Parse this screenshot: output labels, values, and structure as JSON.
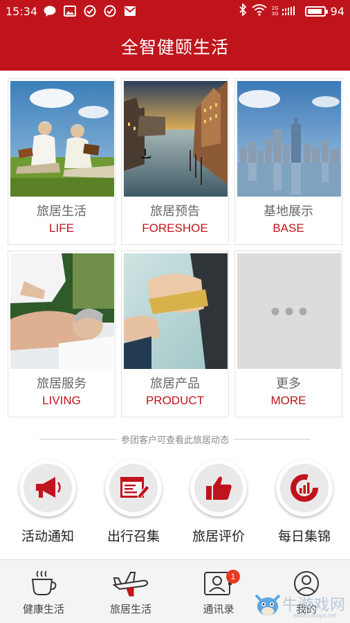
{
  "status_bar": {
    "time": "15:34",
    "signal": "2G 3G",
    "battery": "94",
    "battery_level": 0.94
  },
  "header": {
    "title": "全智健颐生活"
  },
  "cards": [
    {
      "cn": "旅居生活",
      "en": "LIFE"
    },
    {
      "cn": "旅居预告",
      "en": "FORESHOE"
    },
    {
      "cn": "基地展示",
      "en": "BASE"
    },
    {
      "cn": "旅居服务",
      "en": "LIVING"
    },
    {
      "cn": "旅居产品",
      "en": "PRODUCT"
    },
    {
      "cn": "更多",
      "en": "MORE"
    }
  ],
  "divider_text": "参团客户可查看此旅居动态",
  "features": [
    {
      "label": "活动通知",
      "icon": "megaphone-icon"
    },
    {
      "label": "出行召集",
      "icon": "browser-edit-icon"
    },
    {
      "label": "旅居评价",
      "icon": "thumbs-up-icon"
    },
    {
      "label": "每日集锦",
      "icon": "chart-donut-icon"
    }
  ],
  "tabs": [
    {
      "label": "健康生活",
      "icon": "coffee-cup-icon"
    },
    {
      "label": "旅居生活",
      "icon": "airplane-icon"
    },
    {
      "label": "通讯录",
      "icon": "contacts-icon",
      "badge": "1"
    },
    {
      "label": "我的",
      "icon": "user-icon"
    }
  ],
  "watermark": {
    "text": "牛游戏网",
    "url": "www.newyx.net"
  },
  "colors": {
    "brand_red": "#c0141c",
    "badge_red": "#e8391c"
  }
}
